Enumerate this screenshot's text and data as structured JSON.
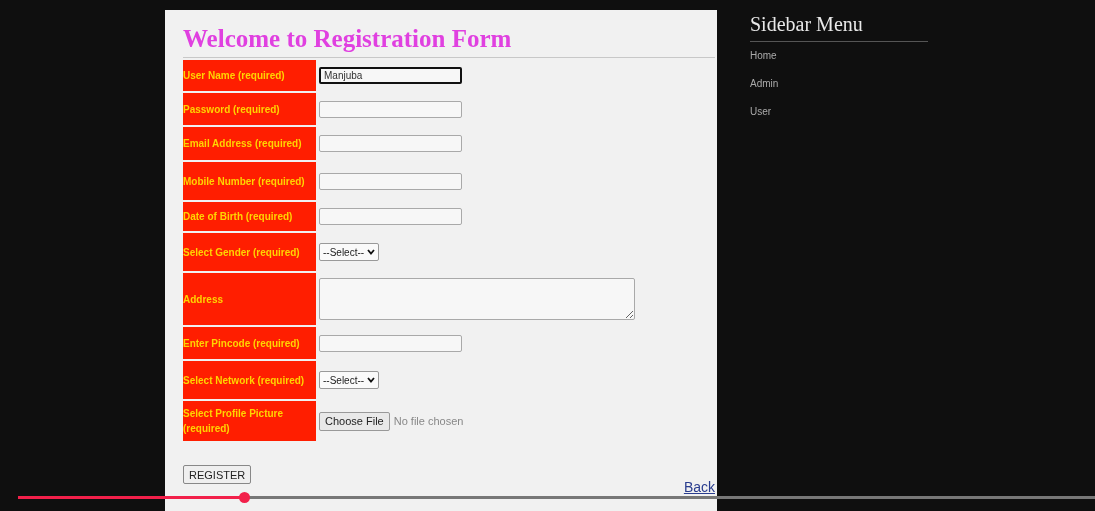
{
  "form": {
    "title": "Welcome to Registration Form",
    "rows": [
      {
        "kind": "text",
        "label": "User Name (required)",
        "value": "Manjuba",
        "focused": true
      },
      {
        "kind": "text",
        "label": "Password (required)",
        "focused": false
      },
      {
        "kind": "text",
        "label": "Email Address (required)",
        "focused": false
      },
      {
        "kind": "text",
        "label": "Mobile Number (required)",
        "focused": false
      },
      {
        "kind": "text",
        "label": "Date of Birth (required)",
        "focused": false
      },
      {
        "kind": "select",
        "label": "Select Gender (required)",
        "value": "--Select--"
      },
      {
        "kind": "textarea",
        "label": "Address",
        "focused": false
      },
      {
        "kind": "text",
        "label": "Enter Pincode (required)",
        "focused": false
      },
      {
        "kind": "select",
        "label": "Select Network (required)",
        "value": "--Select--"
      },
      {
        "kind": "file",
        "label": "Select Profile Picture (required)",
        "button": "Choose File",
        "status": "No file chosen"
      }
    ],
    "submit": "REGISTER",
    "back_link": "Back"
  },
  "sidebar": {
    "title": "Sidebar Menu",
    "items": [
      "Home",
      "Admin",
      "User"
    ]
  },
  "video_progress": {
    "level": 0.21
  }
}
